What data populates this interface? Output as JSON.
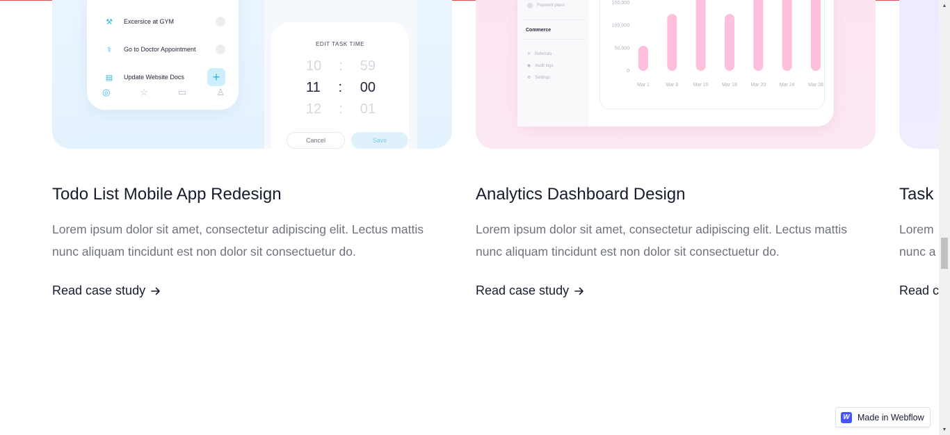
{
  "cards": [
    {
      "title": "Todo List Mobile App Redesign",
      "desc_line1": "Lorem ipsum dolor sit amet, consectetur adipiscing elit. Lectus mattis",
      "desc_line2": "nunc aliquam tincidunt est non dolor sit consectuetur do.",
      "link": "Read case study",
      "accent": "#e5f2fe",
      "mockup": {
        "tasks": [
          "Excersice at GYM",
          "Go to Doctor Appointment",
          "Update Website Docs"
        ],
        "add_symbol": "+",
        "edit_title": "EDIT TASK TIME",
        "times": [
          [
            "10",
            "59"
          ],
          [
            "11",
            "00"
          ],
          [
            "12",
            "01"
          ]
        ],
        "separator": ":",
        "cancel": "Cancel",
        "save": "Save"
      }
    },
    {
      "title": "Analytics Dashboard Design",
      "desc_line1": "Lorem ipsum dolor sit amet, consectetur adipiscing elit. Lectus mattis",
      "desc_line2": "nunc aliquam tincidunt est non dolor sit consectuetur do.",
      "link": "Read case study",
      "accent": "#fde4f1",
      "mockup": {
        "sidebar_top": "Payment plans",
        "sidebar_heading": "Commerce",
        "sidebar_items": [
          "Referrals",
          "Audit logs",
          "Settings"
        ]
      }
    },
    {
      "title": "Task",
      "desc_line1": "Lorem",
      "desc_line2": "nunc a",
      "link": "Read c",
      "accent": "#efeaff"
    }
  ],
  "chart_data": {
    "type": "bar",
    "categories": [
      "Mar 1",
      "Mar 8",
      "Mar 15",
      "Mar 18",
      "Mar 20",
      "Mar 24",
      "Mar 28"
    ],
    "values": [
      55000,
      125000,
      175000,
      125000,
      185000,
      165000,
      185000
    ],
    "ytick_labels": [
      "150,000",
      "100,000",
      "50,000",
      "0"
    ],
    "ytick_values": [
      150000,
      100000,
      50000,
      0
    ],
    "ylim": [
      0,
      200000
    ],
    "bar_color": "#fec0dd"
  },
  "badge": {
    "label": "Made in Webflow",
    "logo": "W"
  }
}
